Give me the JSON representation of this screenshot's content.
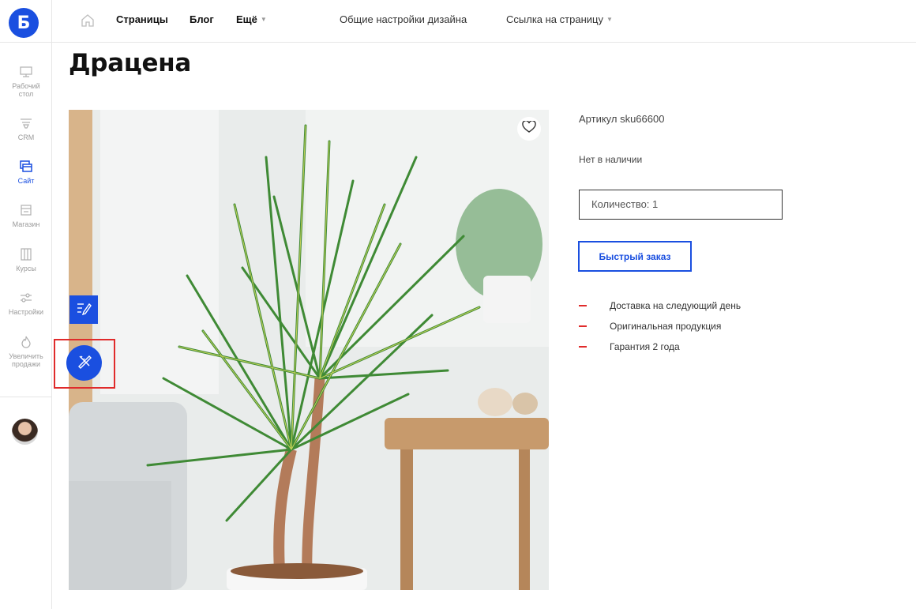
{
  "brand": {
    "logo_letter": "Б",
    "accent_color": "#1a4fe0",
    "highlight_color": "#e02b2b"
  },
  "sidebar": {
    "items": [
      {
        "label": "Рабочий стол",
        "icon": "monitor-icon",
        "active": false
      },
      {
        "label": "CRM",
        "icon": "funnel-icon",
        "active": false
      },
      {
        "label": "Сайт",
        "icon": "site-icon",
        "active": true
      },
      {
        "label": "Магазин",
        "icon": "store-icon",
        "active": false
      },
      {
        "label": "Курсы",
        "icon": "courses-icon",
        "active": false
      },
      {
        "label": "Настройки",
        "icon": "sliders-icon",
        "active": false
      },
      {
        "label": "Увеличить продажи",
        "icon": "flame-icon",
        "active": false
      }
    ]
  },
  "topbar": {
    "nav": {
      "pages": "Страницы",
      "blog": "Блог",
      "more": "Ещё"
    },
    "design_settings": "Общие настройки дизайна",
    "page_link": "Ссылка на страницу"
  },
  "product": {
    "title": "Драцена",
    "sku": "Артикул sku66600",
    "stock_status": "Нет в наличии",
    "quantity_label": "Количество: 1",
    "quick_order_label": "Быстрый заказ",
    "features": [
      "Доставка на следующий день",
      "Оригинальная продукция",
      "Гарантия 2 года"
    ]
  }
}
